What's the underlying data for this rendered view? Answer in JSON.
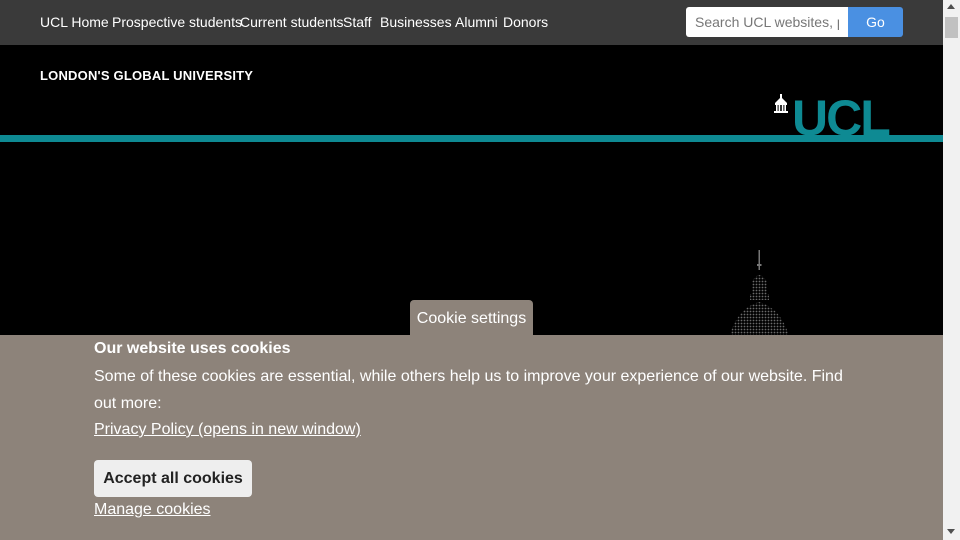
{
  "nav": {
    "items": [
      {
        "label": "UCL Home"
      },
      {
        "label": "Prospective students"
      },
      {
        "label": "Current students"
      },
      {
        "label": "Staff"
      },
      {
        "label": "Businesses"
      },
      {
        "label": "Alumni"
      },
      {
        "label": "Donors"
      }
    ]
  },
  "search": {
    "placeholder": "Search UCL websites, people",
    "go_label": "Go"
  },
  "masthead": {
    "tagline": "LONDON'S GLOBAL UNIVERSITY",
    "logo_text": "UCL",
    "logo_icon": "portico-icon"
  },
  "colors": {
    "nav_bg": "#3a3a3a",
    "brand_teal": "#0e8a93",
    "cookie_bg": "#8d837a",
    "go_button": "#4a90e2"
  },
  "cookie": {
    "tab_label": "Cookie settings",
    "title": "Our website uses cookies",
    "text": "Some of these cookies are essential, while others help us to improve your experience of our website. Find out more:",
    "privacy_link": "Privacy Policy (opens in new window)",
    "accept_label": "Accept all cookies",
    "manage_link": "Manage cookies"
  }
}
